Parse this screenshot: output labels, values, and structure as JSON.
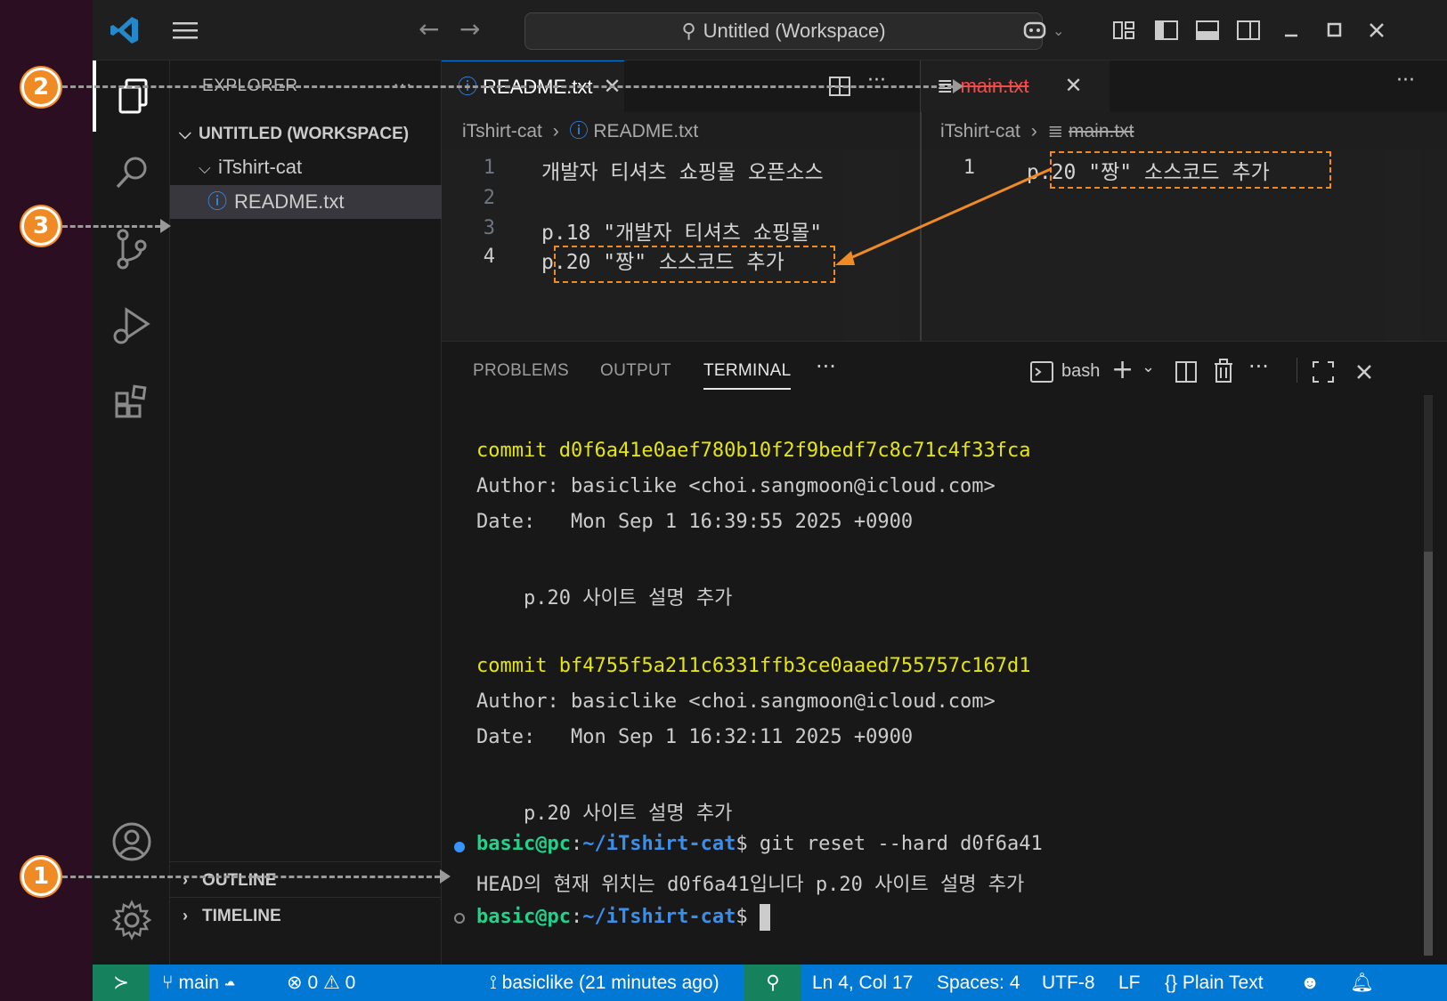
{
  "titlebar": {
    "search_text": "Untitled (Workspace)"
  },
  "sidebar": {
    "title": "EXPLORER",
    "more": "···",
    "workspace": "UNTITLED (WORKSPACE)",
    "folder": "iTshirt-cat",
    "file": "README.txt",
    "outline": "OUTLINE",
    "timeline": "TIMELINE"
  },
  "editor_left": {
    "tab_label": "README.txt",
    "breadcrumb_folder": "iTshirt-cat",
    "breadcrumb_file": "README.txt",
    "lines": [
      {
        "no": "1",
        "text": "개발자 티셔츠 쇼핑몰 오픈소스"
      },
      {
        "no": "2",
        "text": ""
      },
      {
        "no": "3",
        "text": "p.18 \"개발자 티셔츠 쇼핑몰\""
      },
      {
        "no": "4",
        "text": "p.20 \"짱\" 소스코드 추가"
      }
    ]
  },
  "editor_right": {
    "tab_label": "main.txt",
    "breadcrumb_folder": "iTshirt-cat",
    "breadcrumb_file": "main.txt",
    "lines": [
      {
        "no": "1",
        "text": "p.20 \"짱\" 소스코드 추가"
      }
    ]
  },
  "panel": {
    "tabs": [
      "PROBLEMS",
      "OUTPUT",
      "TERMINAL"
    ],
    "active_tab": "TERMINAL",
    "shell": "bash",
    "terminal": {
      "commit1": "commit d0f6a41e0aef780b10f2f9bedf7c8c71c4f33fca",
      "author1": "Author: basiclike <choi.sangmoon@icloud.com>",
      "date1": "Date:   Mon Sep 1 16:39:55 2025 +0900",
      "msg1": "    p.20 사이트 설명 추가",
      "commit2": "commit bf4755f5a211c6331ffb3ce0aaed755757c167d1",
      "author2": "Author: basiclike <choi.sangmoon@icloud.com>",
      "date2": "Date:   Mon Sep 1 16:32:11 2025 +0900",
      "msg2": "    p.20 사이트 설명 추가",
      "prompt_user": "basic@pc",
      "prompt_sep": ":",
      "prompt_path": "~/iTshirt-cat",
      "prompt_dollar": "$",
      "command": " git reset --hard d0f6a41",
      "result": "HEAD의 현재 위치는 d0f6a41입니다 p.20 사이트 설명 추가"
    }
  },
  "statusbar": {
    "branch": "main",
    "errors": "0",
    "warnings": "0",
    "blame": "basiclike (21 minutes ago)",
    "position": "Ln 4, Col 17",
    "spaces": "Spaces: 4",
    "encoding": "UTF-8",
    "eol": "LF",
    "language": "Plain Text"
  },
  "annotations": [
    "1",
    "2",
    "3"
  ],
  "colors": {
    "accent": "#0078d4",
    "marker": "#f08a24",
    "terminal_yellow": "#e5e510",
    "terminal_green": "#23d18b",
    "terminal_blue": "#3b8eea"
  }
}
